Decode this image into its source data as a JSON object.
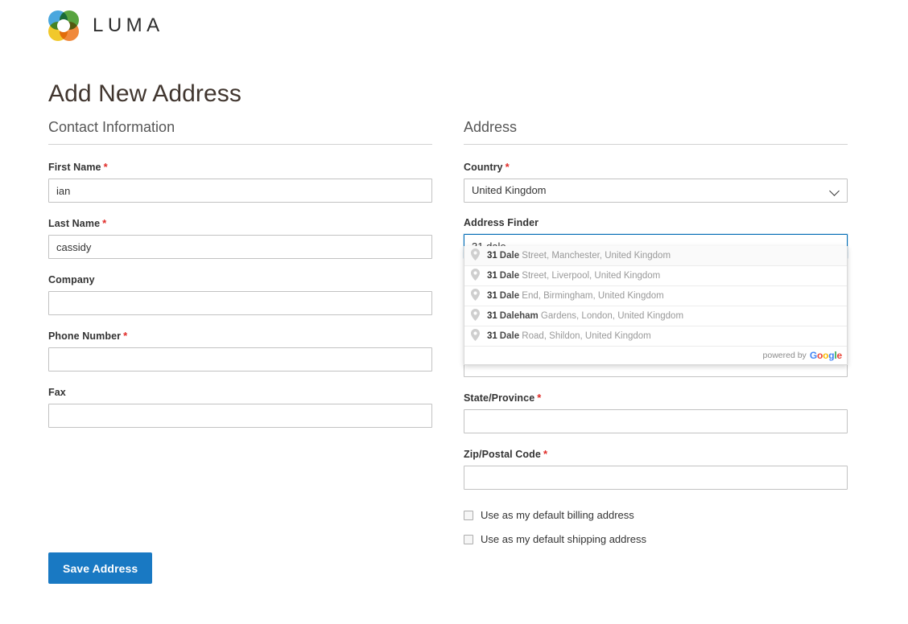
{
  "brand": {
    "name": "LUMA",
    "icon": "luma-flower-logo"
  },
  "page": {
    "title": "Add New Address"
  },
  "contact": {
    "section_title": "Contact Information",
    "fields": [
      {
        "label": "First Name",
        "required_mark": "*",
        "value": "ian",
        "name": "first-name"
      },
      {
        "label": "Last Name",
        "required_mark": "*",
        "value": "cassidy",
        "name": "last-name"
      },
      {
        "label": "Company",
        "required_mark": "",
        "value": "",
        "name": "company"
      },
      {
        "label": "Phone Number",
        "required_mark": "*",
        "value": "",
        "name": "phone-number"
      },
      {
        "label": "Fax",
        "required_mark": "",
        "value": "",
        "name": "fax"
      }
    ]
  },
  "address": {
    "section_title": "Address",
    "country": {
      "label": "Country",
      "required_mark": "*",
      "value": "United Kingdom",
      "icon": "chevron-down-icon"
    },
    "address_finder": {
      "label": "Address Finder",
      "value": "31 dale",
      "focused": true
    },
    "street": {
      "label": "",
      "value": ""
    },
    "state": {
      "label": "State/Province",
      "required_mark": "*",
      "value": ""
    },
    "zip": {
      "label": "Zip/Postal Code",
      "required_mark": "*",
      "value": ""
    },
    "checkboxes": [
      {
        "label": "Use as my default billing address",
        "checked": false,
        "name": "default-billing"
      },
      {
        "label": "Use as my default shipping address",
        "checked": false,
        "name": "default-shipping"
      }
    ]
  },
  "autocomplete": {
    "icon": "map-pin-icon",
    "items": [
      {
        "main": "31",
        "match": "Dale",
        "rest": " Street, Manchester, United Kingdom",
        "active": true
      },
      {
        "main": "31",
        "match": "Dale",
        "rest": " Street, Liverpool, United Kingdom",
        "active": false
      },
      {
        "main": "31",
        "match": "Dale",
        "rest": " End, Birmingham, United Kingdom",
        "active": false
      },
      {
        "main": "31",
        "match": "Daleham",
        "rest": " Gardens, London, United Kingdom",
        "active": false
      },
      {
        "main": "31",
        "match": "Dale",
        "rest": " Road, Shildon, United Kingdom",
        "active": false
      }
    ],
    "footer_text": "powered by",
    "footer_brand": "Google"
  },
  "actions": {
    "save_label": "Save Address"
  },
  "colors": {
    "accent": "#1979c3",
    "required": "#e02b27",
    "focus_border": "#006bb4",
    "text": "#333333"
  }
}
